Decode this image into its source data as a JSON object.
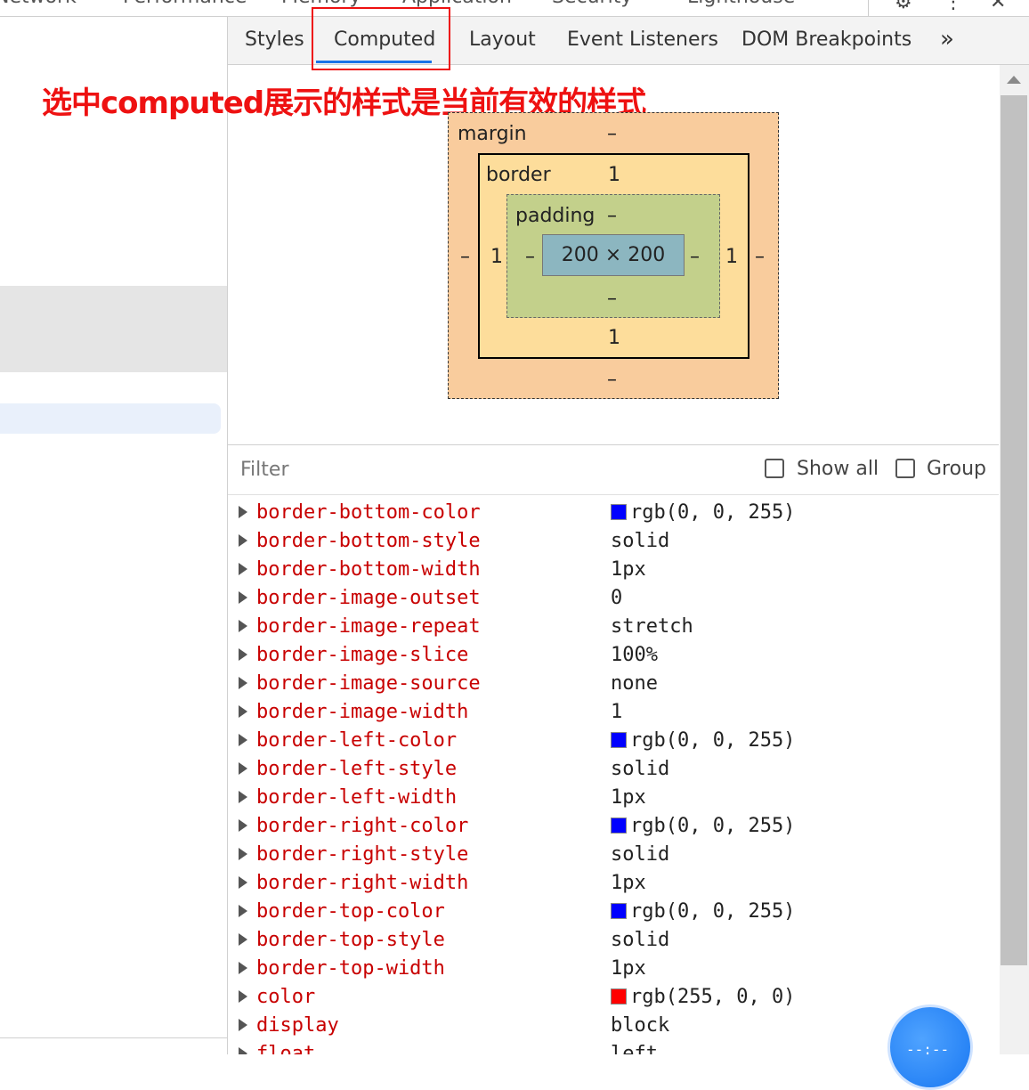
{
  "top_tabs": [
    "Network",
    "Performance",
    "Memory",
    "Application",
    "Security",
    "Lighthouse"
  ],
  "sub_tabs": [
    {
      "label": "Styles"
    },
    {
      "label": "Computed",
      "active": true
    },
    {
      "label": "Layout"
    },
    {
      "label": "Event Listeners"
    },
    {
      "label": "DOM Breakpoints"
    }
  ],
  "more_tabs_icon": "chevron-double-right-icon",
  "annotation": "选中computed展示的样式是当前有效的样式",
  "box_model": {
    "margin": {
      "label": "margin",
      "top": "–",
      "right": "–",
      "bottom": "–",
      "left": "–"
    },
    "border": {
      "label": "border",
      "top": "1",
      "right": "1",
      "bottom": "1",
      "left": "1"
    },
    "padding": {
      "label": "padding",
      "top": "–",
      "right": "–",
      "bottom": "–",
      "left": "–"
    },
    "content": "200 × 200"
  },
  "filter": {
    "placeholder": "Filter",
    "show_all": "Show all",
    "group": "Group"
  },
  "properties": [
    {
      "name": "border-bottom-color",
      "value": "rgb(0, 0, 255)",
      "swatch": "#0000ff"
    },
    {
      "name": "border-bottom-style",
      "value": "solid"
    },
    {
      "name": "border-bottom-width",
      "value": "1px"
    },
    {
      "name": "border-image-outset",
      "value": "0"
    },
    {
      "name": "border-image-repeat",
      "value": "stretch"
    },
    {
      "name": "border-image-slice",
      "value": "100%"
    },
    {
      "name": "border-image-source",
      "value": "none"
    },
    {
      "name": "border-image-width",
      "value": "1"
    },
    {
      "name": "border-left-color",
      "value": "rgb(0, 0, 255)",
      "swatch": "#0000ff"
    },
    {
      "name": "border-left-style",
      "value": "solid"
    },
    {
      "name": "border-left-width",
      "value": "1px"
    },
    {
      "name": "border-right-color",
      "value": "rgb(0, 0, 255)",
      "swatch": "#0000ff"
    },
    {
      "name": "border-right-style",
      "value": "solid"
    },
    {
      "name": "border-right-width",
      "value": "1px"
    },
    {
      "name": "border-top-color",
      "value": "rgb(0, 0, 255)",
      "swatch": "#0000ff"
    },
    {
      "name": "border-top-style",
      "value": "solid"
    },
    {
      "name": "border-top-width",
      "value": "1px"
    },
    {
      "name": "color",
      "value": "rgb(255, 0, 0)",
      "swatch": "#ff0000"
    },
    {
      "name": "display",
      "value": "block"
    },
    {
      "name": "float",
      "value": "left"
    }
  ],
  "colors": {
    "property_name": "#c80000",
    "active_tab_underline": "#1a73e8",
    "annotation": "#ee1111"
  }
}
